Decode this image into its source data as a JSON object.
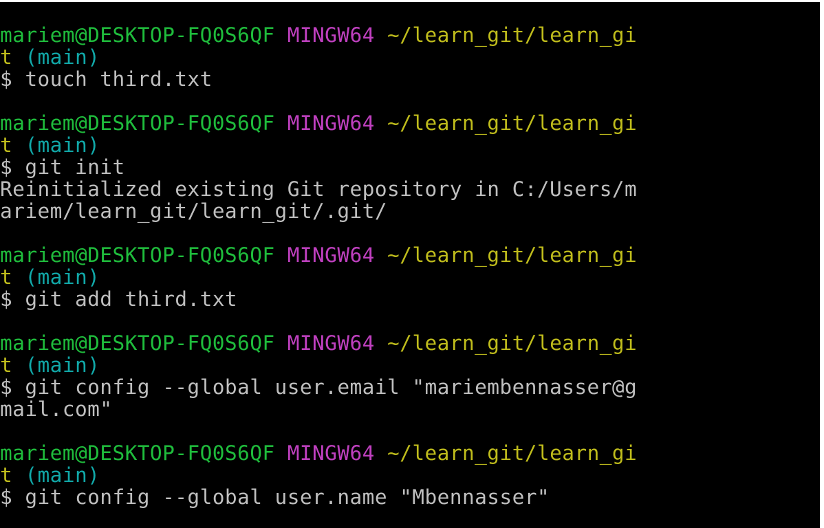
{
  "colors": {
    "background": "#000000",
    "user_host": "#1fbc3c",
    "system": "#bf40bf",
    "path": "#bfbc1c",
    "branch": "#11a8a8",
    "text": "#bfbfbf"
  },
  "terminal": {
    "blocks": [
      {
        "prompt": {
          "user_host": "mariem@DESKTOP-FQ0S6QF",
          "system": "MINGW64",
          "path_part1": "~/learn_git/learn_gi",
          "path_part2": "t",
          "branch": "(main)"
        },
        "command": "$ touch third.txt",
        "output": []
      },
      {
        "prompt": {
          "user_host": "mariem@DESKTOP-FQ0S6QF",
          "system": "MINGW64",
          "path_part1": "~/learn_git/learn_gi",
          "path_part2": "t",
          "branch": "(main)"
        },
        "command": "$ git init",
        "output": [
          "Reinitialized existing Git repository in C:/Users/m",
          "ariem/learn_git/learn_git/.git/"
        ]
      },
      {
        "prompt": {
          "user_host": "mariem@DESKTOP-FQ0S6QF",
          "system": "MINGW64",
          "path_part1": "~/learn_git/learn_gi",
          "path_part2": "t",
          "branch": "(main)"
        },
        "command": "$ git add third.txt",
        "output": []
      },
      {
        "prompt": {
          "user_host": "mariem@DESKTOP-FQ0S6QF",
          "system": "MINGW64",
          "path_part1": "~/learn_git/learn_gi",
          "path_part2": "t",
          "branch": "(main)"
        },
        "command": "$ git config --global user.email \"mariembennasser@g",
        "command_cont": "mail.com\"",
        "output": []
      },
      {
        "prompt": {
          "user_host": "mariem@DESKTOP-FQ0S6QF",
          "system": "MINGW64",
          "path_part1": "~/learn_git/learn_gi",
          "path_part2": "t",
          "branch": "(main)"
        },
        "command": "$ git config --global user.name \"Mbennasser\"",
        "output": []
      }
    ]
  }
}
